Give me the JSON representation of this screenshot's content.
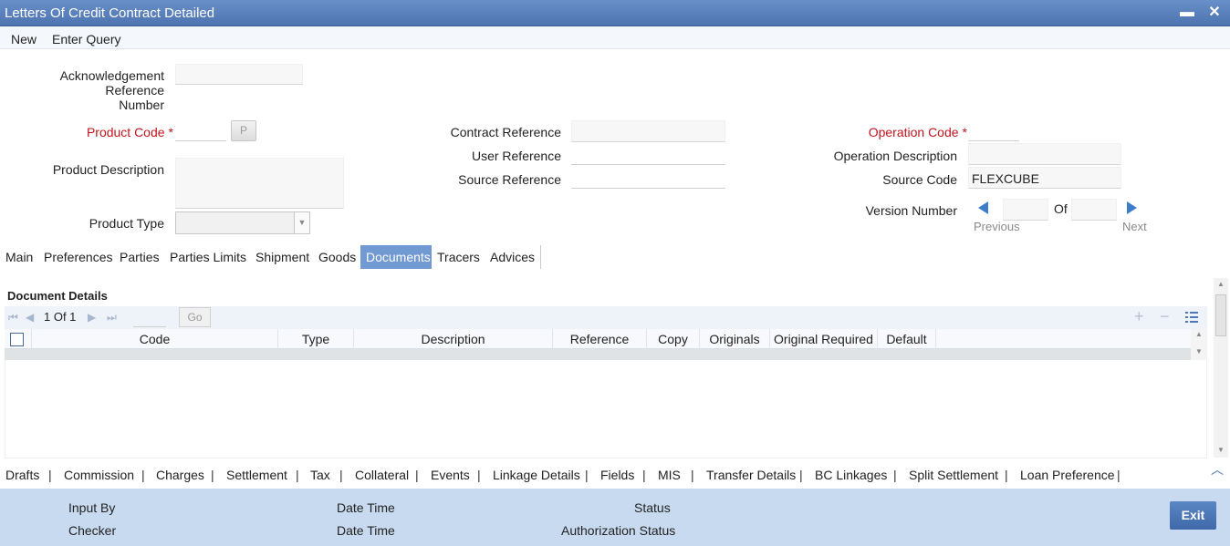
{
  "window": {
    "title": "Letters Of Credit Contract Detailed",
    "minimize_glyph": "▬",
    "close_glyph": "✕"
  },
  "menu": {
    "new": "New",
    "enter_query": "Enter Query"
  },
  "form": {
    "ack_ref_label_line1": "Acknowledgement Reference",
    "ack_ref_label_line2": "Number",
    "ack_ref_value": "",
    "product_code_label": "Product Code",
    "product_code_value": "",
    "product_button": "P",
    "product_description_label": "Product Description",
    "product_type_label": "Product Type",
    "contract_reference_label": "Contract Reference",
    "user_reference_label": "User Reference",
    "source_reference_label": "Source Reference",
    "operation_code_label": "Operation Code",
    "operation_description_label": "Operation Description",
    "source_code_label": "Source Code",
    "source_code_value": "FLEXCUBE",
    "version_number_label": "Version Number",
    "version_of": "Of",
    "previous_label": "Previous",
    "next_label": "Next",
    "required_mark": "*"
  },
  "tabs": [
    "Main",
    "Preferences",
    "Parties",
    "Parties Limits",
    "Shipment",
    "Goods",
    "Documents",
    "Tracers",
    "Advices"
  ],
  "active_tab": "Documents",
  "documents": {
    "section_title": "Document Details",
    "pager_text": "1 Of 1",
    "go_label": "Go",
    "columns": [
      "Code",
      "Type",
      "Description",
      "Reference",
      "Copy",
      "Originals",
      "Original Required",
      "Default"
    ]
  },
  "bottom_links": [
    "Drafts",
    "Commission",
    "Charges",
    "Settlement",
    "Tax",
    "Collateral",
    "Events",
    "Linkage Details",
    "Fields",
    "MIS",
    "Transfer Details",
    "BC Linkages",
    "Split Settlement",
    "Loan Preference"
  ],
  "footer": {
    "input_by": "Input By",
    "checker": "Checker",
    "date_time_1": "Date Time",
    "date_time_2": "Date Time",
    "status": "Status",
    "authorization_status": "Authorization Status",
    "exit_label": "Exit"
  },
  "colors": {
    "titlebar": "#5580bd",
    "active_tab": "#7199d2",
    "footer": "#c8daf0",
    "required": "#c0151f"
  }
}
